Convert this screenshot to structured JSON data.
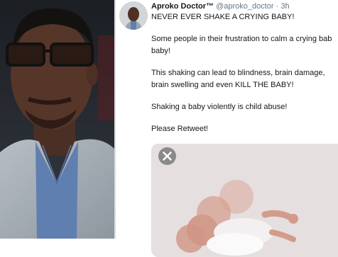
{
  "tweet": {
    "author_name": "Aproko Doctor™",
    "handle": "@aproko_doctor",
    "separator": "·",
    "time": "3h",
    "paragraphs": [
      "NEVER EVER SHAKE A CRYING BABY!",
      "Some people in their frustration to calm a crying bab",
      "baby!",
      "This shaking can lead to blindness, brain damage,",
      "brain swelling and even KILL THE BABY!",
      "Shaking a baby violently is child abuse!",
      "Please Retweet!"
    ]
  },
  "media": {
    "close_icon": "close-icon"
  },
  "colors": {
    "text": "#14171a",
    "muted": "#657786",
    "media_bg": "#e4dddd"
  }
}
